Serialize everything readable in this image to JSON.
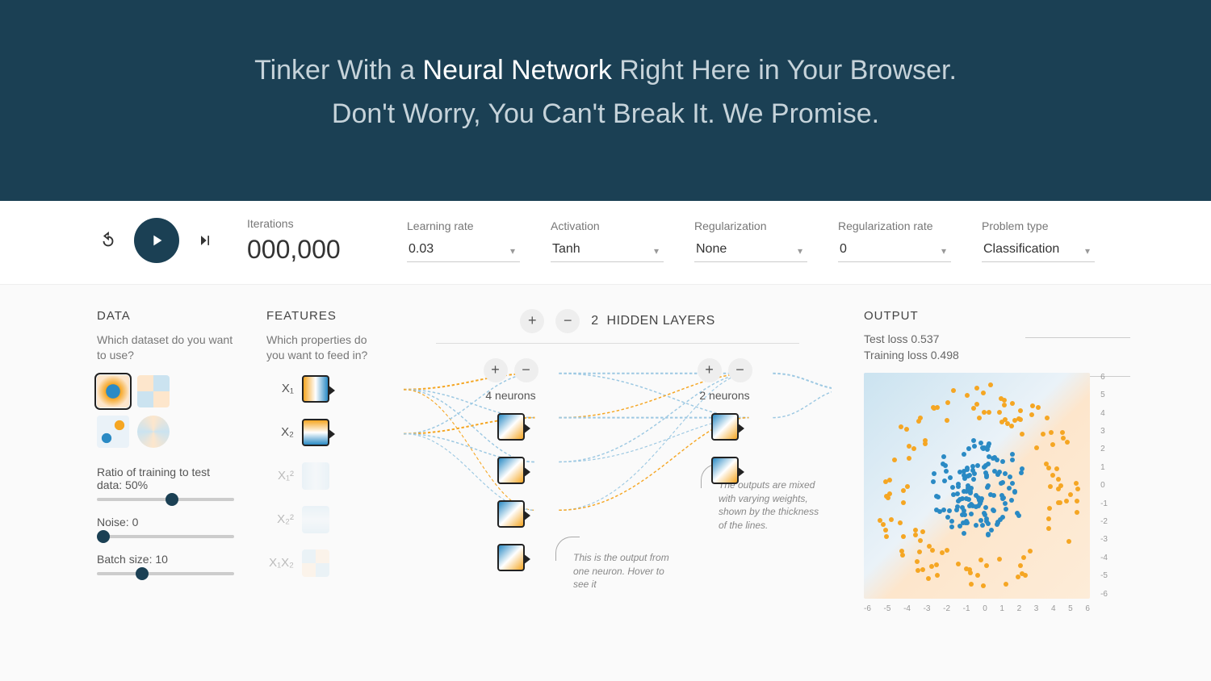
{
  "hero": {
    "line1_pre": "Tinker With a ",
    "line1_bold": "Neural Network",
    "line1_post": " Right Here in Your Browser.",
    "line2": "Don't Worry, You Can't Break It. We Promise."
  },
  "toolbar": {
    "iterations_label": "Iterations",
    "iterations_value": "000,000",
    "learning_rate_label": "Learning rate",
    "learning_rate_value": "0.03",
    "activation_label": "Activation",
    "activation_value": "Tanh",
    "regularization_label": "Regularization",
    "regularization_value": "None",
    "reg_rate_label": "Regularization rate",
    "reg_rate_value": "0",
    "problem_label": "Problem type",
    "problem_value": "Classification"
  },
  "data": {
    "title": "DATA",
    "subtitle": "Which dataset do you want to use?",
    "ratio_label": "Ratio of training to test data:  50%",
    "ratio_pct": 50,
    "noise_label": "Noise:  0",
    "noise_pct": 0,
    "batch_label": "Batch size:  10",
    "batch_pct": 30
  },
  "features": {
    "title": "FEATURES",
    "subtitle": "Which properties do you want to feed in?",
    "items": [
      {
        "label": "X₁",
        "active": true
      },
      {
        "label": "X₂",
        "active": true
      },
      {
        "label": "X₁²",
        "active": false
      },
      {
        "label": "X₂²",
        "active": false
      },
      {
        "label": "X₁X₂",
        "active": false
      }
    ]
  },
  "network": {
    "count": "2",
    "title": "HIDDEN LAYERS",
    "layers": [
      {
        "neurons_label": "4 neurons",
        "count": 4
      },
      {
        "neurons_label": "2 neurons",
        "count": 2
      }
    ],
    "callout_neuron": "This is the output from one neuron. Hover to see it",
    "callout_weights": "The outputs are mixed with varying weights, shown by the thickness of the lines."
  },
  "output": {
    "title": "OUTPUT",
    "test_loss": "Test loss 0.537",
    "training_loss": "Training loss 0.498",
    "axis_right": [
      "6",
      "5",
      "4",
      "3",
      "2",
      "1",
      "0",
      "-1",
      "-2",
      "-3",
      "-4",
      "-5",
      "-6"
    ],
    "axis_bottom": [
      "-6",
      "-5",
      "-4",
      "-3",
      "-2",
      "-1",
      "0",
      "1",
      "2",
      "3",
      "4",
      "5",
      "6"
    ]
  },
  "colors": {
    "blue": "#2a8ac4",
    "orange": "#f5a623"
  }
}
